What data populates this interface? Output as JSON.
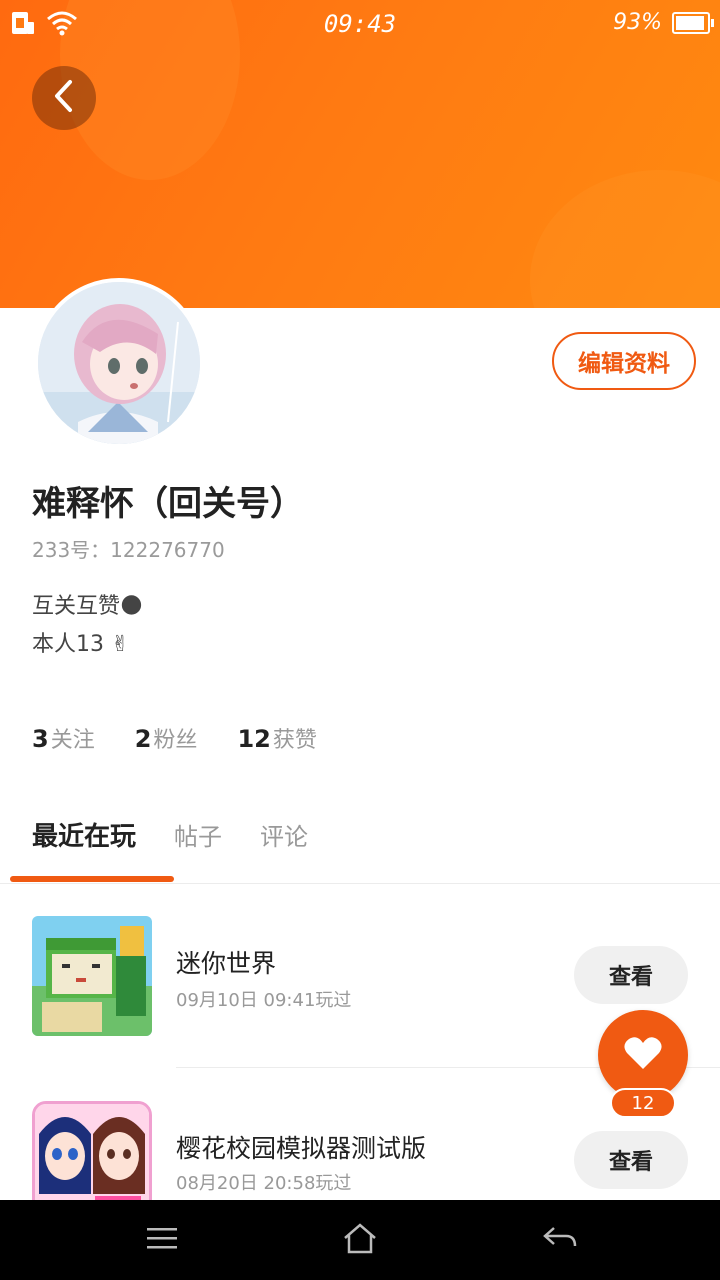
{
  "status_bar": {
    "time": "09:43",
    "battery_percent_text": "93%",
    "battery_level": 0.93,
    "icons": [
      "sim-icon",
      "wifi-icon",
      "battery-icon"
    ]
  },
  "header": {
    "back_icon": "chevron-left-icon",
    "accent_color": "#ff7a12"
  },
  "profile": {
    "edit_label": "编辑资料",
    "name": "难释怀（回关号）",
    "uid_text": "233号：122276770",
    "bio_line1": "互关互赞🌑",
    "bio_line2": "本人13 ✌"
  },
  "stats": [
    {
      "num": "3",
      "label": "关注"
    },
    {
      "num": "2",
      "label": "粉丝"
    },
    {
      "num": "12",
      "label": "获赞"
    }
  ],
  "tabs": [
    {
      "label": "最近在玩",
      "active": true
    },
    {
      "label": "帖子",
      "active": false
    },
    {
      "label": "评论",
      "active": false
    }
  ],
  "games": [
    {
      "title": "迷你世界",
      "played": "09月10日 09:41玩过",
      "button": "查看"
    },
    {
      "title": "樱花校园模拟器测试版",
      "played": "08月20日 20:58玩过",
      "button": "查看"
    }
  ],
  "like": {
    "count": "12",
    "icon": "heart-icon"
  },
  "nav": {
    "icons": [
      "menu-icon",
      "home-icon",
      "back-arrow-icon"
    ]
  }
}
